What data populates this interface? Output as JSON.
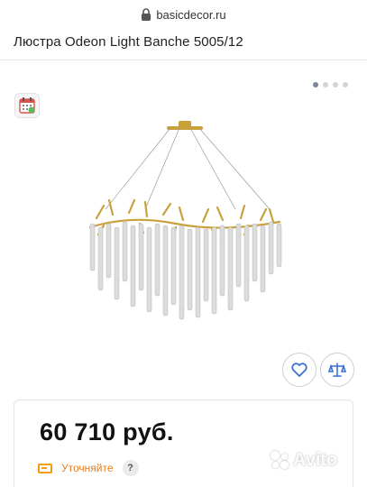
{
  "browser": {
    "url": "basicdecor.ru"
  },
  "product": {
    "title": "Люстра Odeon Light Banche 5005/12"
  },
  "gallery": {
    "total_slides": 4,
    "active_index": 0
  },
  "price": {
    "value": "60 710 руб.",
    "clarify_label": "Уточняйте",
    "help_symbol": "?"
  },
  "watermark": {
    "text": "Avito"
  },
  "colors": {
    "accent_orange": "#e67e22",
    "gold": "#c9a13b",
    "button_blue": "#3b6fd8"
  }
}
